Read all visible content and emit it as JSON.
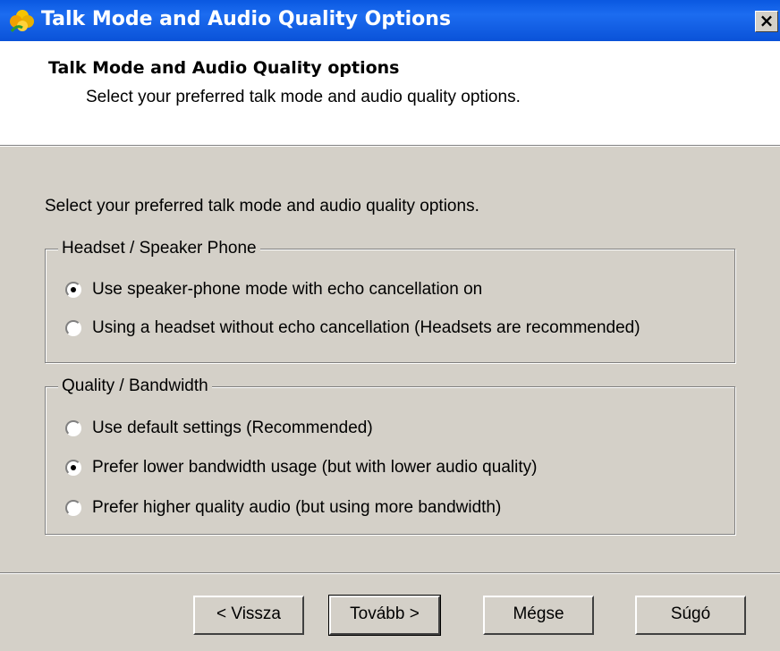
{
  "window": {
    "title": "Talk Mode and Audio Quality Options",
    "close_label": "×"
  },
  "header": {
    "title": "Talk Mode and Audio Quality options",
    "subtitle": "Select your preferred talk mode and audio quality options."
  },
  "intro": "Select your preferred talk mode and audio quality options.",
  "groups": [
    {
      "legend": "Headset / Speaker Phone",
      "options": [
        {
          "label": "Use speaker-phone mode with echo cancellation on",
          "checked": true
        },
        {
          "label": "Using a headset without echo cancellation (Headsets are recommended)",
          "checked": false
        }
      ]
    },
    {
      "legend": "Quality / Bandwidth",
      "options": [
        {
          "label": "Use default settings (Recommended)",
          "checked": false
        },
        {
          "label": "Prefer lower bandwidth usage (but with lower audio quality)",
          "checked": true
        },
        {
          "label": "Prefer higher quality audio (but using more bandwidth)",
          "checked": false
        }
      ]
    }
  ],
  "buttons": {
    "back": "< Vissza",
    "next": "Tovább >",
    "cancel": "Mégse",
    "help": "Súgó"
  },
  "icons": {
    "title_icon": "app-flower-icon"
  },
  "colors": {
    "titlebar": "#0a58e0",
    "dialog_bg": "#d4d0c8",
    "header_bg": "#ffffff"
  }
}
